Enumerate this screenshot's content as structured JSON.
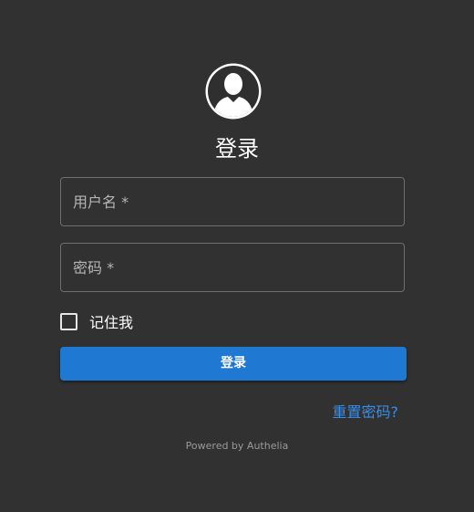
{
  "login": {
    "title": "登录",
    "username_placeholder": "用户名 *",
    "password_placeholder": "密码 *",
    "remember_label": "记住我",
    "remember_checked": false,
    "submit_label": "登录",
    "reset_link": "重置密码?",
    "footer": "Powered by Authelia"
  },
  "icons": {
    "avatar": "user-avatar-icon",
    "checkbox": "checkbox-icon"
  },
  "colors": {
    "background": "#313131",
    "primary": "#1f78d1",
    "link": "#3a8ee6"
  }
}
